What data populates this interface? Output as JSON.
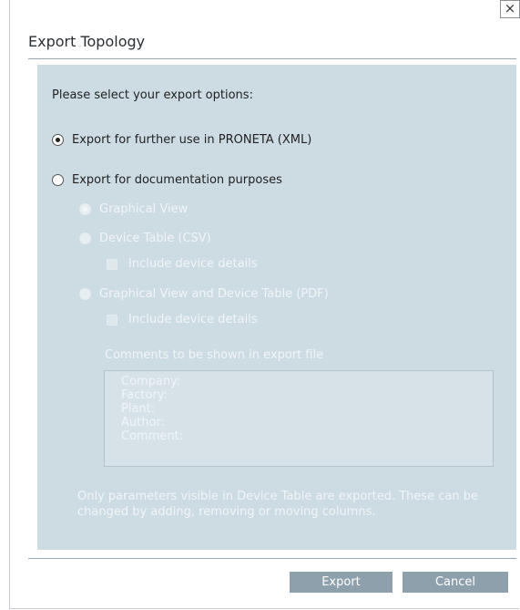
{
  "dialog": {
    "title": "Export Topology",
    "close_glyph": "×"
  },
  "options": {
    "prompt": "Please select your export options:",
    "xml_label": "Export for further use in PRONETA (XML)",
    "doc_label": "Export for documentation purposes",
    "graphical_view_label": "Graphical View",
    "device_table_label": "Device Table (CSV)",
    "include_details_csv_label": "Include device details",
    "graphical_pdf_label": "Graphical View and Device Table (PDF)",
    "include_details_pdf_label": "Include device details"
  },
  "comments": {
    "label": "Comments to be shown in export file",
    "lines": [
      "Company:",
      "Factory:",
      "Plant:",
      "Author:",
      "Comment:"
    ]
  },
  "note": "Only parameters visible in Device Table are exported. These can be changed by adding, removing or moving columns.",
  "footer": {
    "export_label": "Export",
    "cancel_label": "Cancel"
  }
}
